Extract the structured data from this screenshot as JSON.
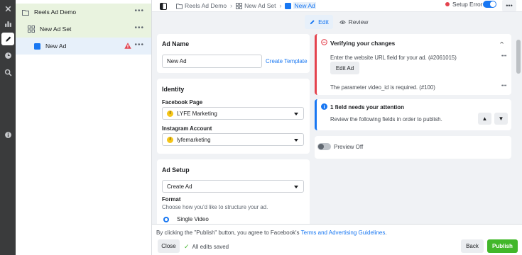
{
  "tree": {
    "campaign": "Reels Ad Demo",
    "adset": "New Ad Set",
    "ad": "New Ad"
  },
  "breadcrumb": {
    "campaign": "Reels Ad Demo",
    "adset": "New Ad Set",
    "ad": "New Ad"
  },
  "status": {
    "setup_error": "Setup Error"
  },
  "modes": {
    "edit": "Edit",
    "review": "Review"
  },
  "ad_name": {
    "title": "Ad Name",
    "value": "New Ad",
    "create_template": "Create Template"
  },
  "identity": {
    "title": "Identity",
    "facebook_page_label": "Facebook Page",
    "facebook_page_value": "LYFE Marketing",
    "instagram_account_label": "Instagram Account",
    "instagram_account_value": "lyfemarketing"
  },
  "ad_setup": {
    "title": "Ad Setup",
    "setup_value": "Create Ad",
    "format_label": "Format",
    "format_help": "Choose how you'd like to structure your ad.",
    "format_option": "Single Video"
  },
  "verify": {
    "title": "Verifying your changes",
    "message1": "Enter the website URL field for your ad. (#2061015)",
    "edit_ad": "Edit Ad",
    "message2": "The parameter video_id is required. (#100)"
  },
  "attention": {
    "title": "1 field needs your attention",
    "message": "Review the following fields in order to publish."
  },
  "preview": {
    "label": "Preview Off"
  },
  "footer": {
    "terms_prefix": "By clicking the \"Publish\" button, you agree to Facebook's",
    "terms_link": "Terms and Advertising Guidelines",
    "terms_suffix": ".",
    "close": "Close",
    "saved": "All edits saved",
    "back": "Back",
    "publish": "Publish"
  },
  "colors": {
    "accent": "#1877f2",
    "error": "#e4434e",
    "publish": "#42b72a"
  }
}
